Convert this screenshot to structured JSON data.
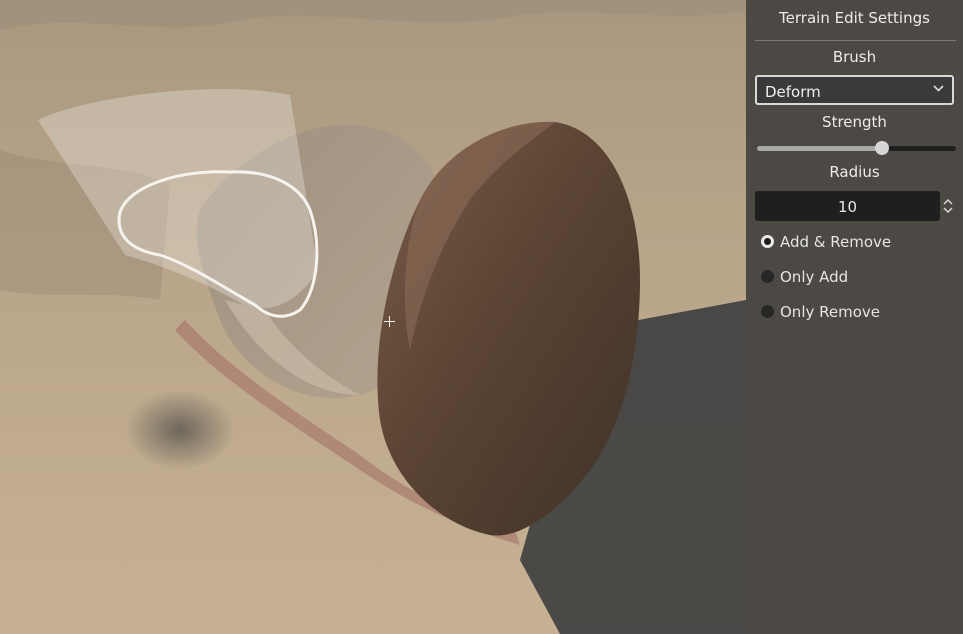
{
  "panel": {
    "title": "Terrain Edit Settings",
    "brush_label": "Brush",
    "brush_value": "Deform",
    "strength_label": "Strength",
    "strength_value": 0.63,
    "radius_label": "Radius",
    "radius_value": "10",
    "modes": [
      {
        "label": "Add & Remove",
        "selected": true
      },
      {
        "label": "Only Add",
        "selected": false
      },
      {
        "label": "Only Remove",
        "selected": false
      }
    ]
  },
  "icons": {
    "brush_dropdown": "chevron-down-icon",
    "radius_spinner": "up-down-arrows-icon",
    "cursor": "crosshair-icon"
  },
  "colors": {
    "sand": "#b9a58a",
    "rock": "#5a4536",
    "panel_bg": "#343434"
  }
}
